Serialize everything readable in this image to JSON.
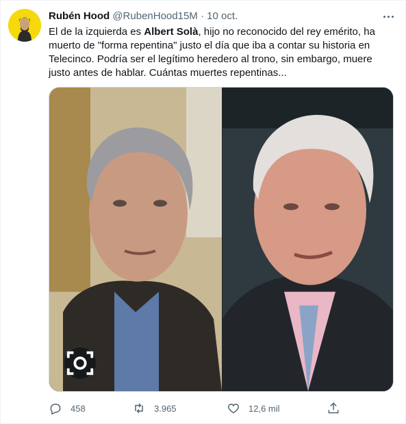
{
  "tweet": {
    "author_name": "Rubén Hood",
    "author_handle": "@RubenHood15M",
    "separator": "·",
    "date": "10 oct.",
    "text_part1": "El de la izquierda es ",
    "text_bold": "Albert Solà",
    "text_part2": ", hijo no reconocido del rey emérito, ha muerto de \"forma repentina\" justo el día que iba a contar su historia en Telecinco. Podría ser el legítimo heredero al trono, sin embargo, muere justo antes de hablar. Cuántas muertes repentinas..."
  },
  "actions": {
    "replies": "458",
    "retweets": "3.965",
    "likes": "12,6 mil"
  },
  "icons": {
    "more": "more-dots-icon",
    "reply": "reply-icon",
    "retweet": "retweet-icon",
    "like": "heart-icon",
    "share": "share-icon",
    "alt": "lens-icon"
  },
  "colors": {
    "text_primary": "#0f1419",
    "text_secondary": "#536471",
    "avatar_bg": "#f5d90a",
    "border": "#cfd9de"
  }
}
